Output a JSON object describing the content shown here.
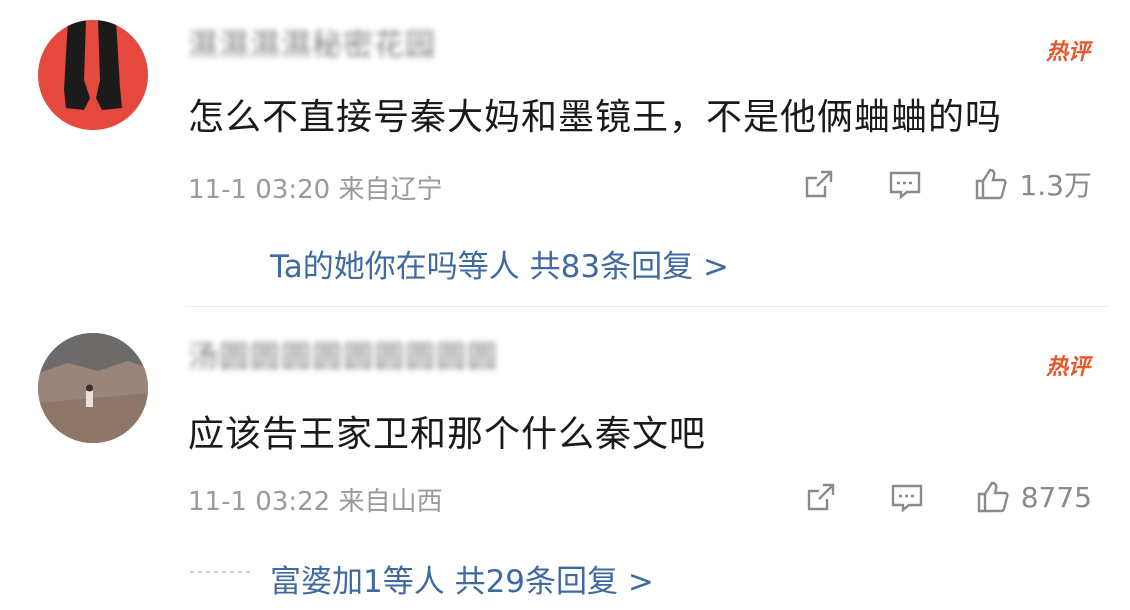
{
  "comments": [
    {
      "username": "濕濕濕濕秘密花园",
      "hot_badge": "热评",
      "text": "怎么不直接号秦大妈和墨镜王，不是他俩蛐蛐的吗",
      "time": "11-1 03:20",
      "location": "来自辽宁",
      "likes": "1.3万",
      "replies_text": "Ta的她你在吗等人  共83条回复 >"
    },
    {
      "username": "汤圆圆圆圆圆圆圆圆圆",
      "hot_badge": "热评",
      "text": "应该告王家卫和那个什么秦文吧",
      "time": "11-1 03:22",
      "location": "来自山西",
      "likes": "8775",
      "replies_text": "富婆加1等人  共29条回复 >"
    }
  ],
  "icons": {
    "share": "share-icon",
    "comment": "comment-icon",
    "like": "thumbs-up-icon"
  },
  "colors": {
    "hot_badge": "#e8562a",
    "reply_link": "#3e6aa0",
    "meta": "#9a9a9a"
  }
}
